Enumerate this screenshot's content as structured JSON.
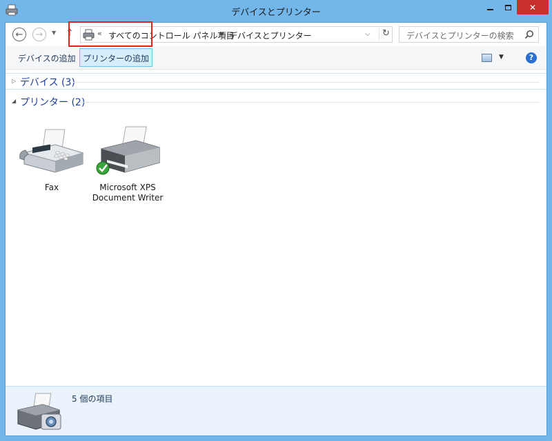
{
  "window": {
    "title": "デバイスとプリンター",
    "close_symbol": "✕"
  },
  "address": {
    "chevrons": "«",
    "segment1": "すべてのコントロール パネル項目",
    "segment2": "デバイスとプリンター",
    "search_placeholder": "デバイスとプリンターの検索"
  },
  "commands": {
    "add_device": "デバイスの追加",
    "add_printer": "プリンターの追加",
    "help": "?"
  },
  "groups": {
    "devices": "デバイス (3)",
    "printers": "プリンター (2)"
  },
  "printers": [
    {
      "label": "Fax"
    },
    {
      "label": "Microsoft XPS Document Writer"
    }
  ],
  "details": {
    "count_text": "5 個の項目"
  },
  "colors": {
    "accent": "#e2231a",
    "frame": "#72b6ea",
    "group_title": "#1e3f9e",
    "close_button": "#c7302b"
  }
}
